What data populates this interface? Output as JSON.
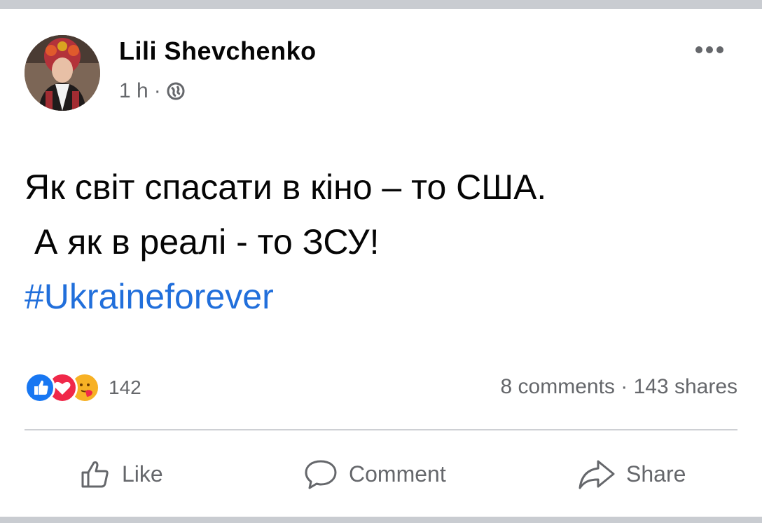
{
  "post": {
    "author": "Lili  Shevchenko",
    "time": "1 h",
    "separator": "·",
    "text_line1": "Як світ спасати в кіно – то США.",
    "text_line2": "А як в реалі - то ЗСУ!",
    "hashtag": "#Ukraineforever"
  },
  "stats": {
    "reaction_count": "142",
    "comments_shares": "8 comments · 143 shares",
    "reaction_icons": [
      "like-icon",
      "love-icon",
      "care-icon"
    ]
  },
  "actions": {
    "like": "Like",
    "comment": "Comment",
    "share": "Share"
  },
  "colors": {
    "hashtag": "#216fdb",
    "like_blue": "#1877f2",
    "love_red": "#f02849",
    "care_yellow": "#f7b125",
    "secondary_text": "#65676b"
  }
}
